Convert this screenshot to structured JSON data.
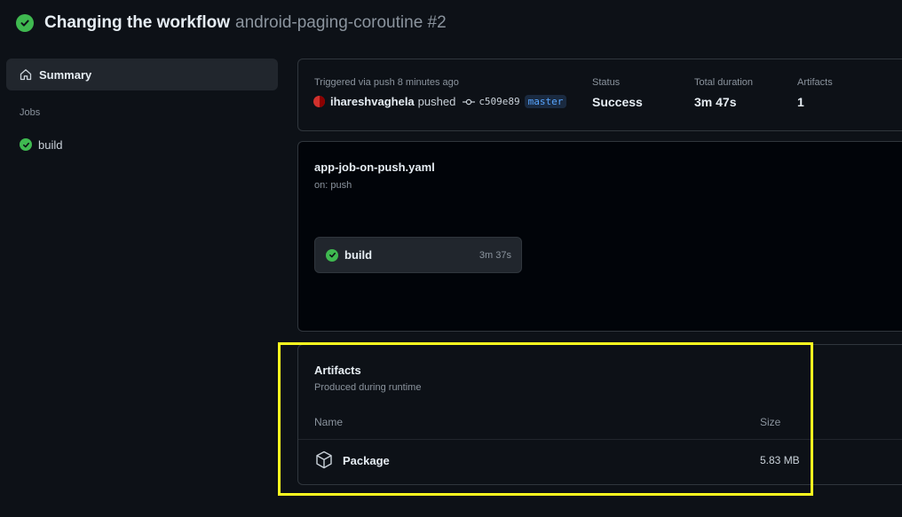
{
  "header": {
    "status_icon": "check-circle-icon",
    "title": "Changing the workflow",
    "subtitle": "android-paging-coroutine #2"
  },
  "sidebar": {
    "summary_label": "Summary",
    "summary_icon": "home-icon",
    "jobs_label": "Jobs",
    "jobs": [
      {
        "label": "build",
        "status": "success"
      }
    ]
  },
  "summary": {
    "trigger_label": "Triggered via push 8 minutes ago",
    "actor": "ihareshvaghela",
    "action": "pushed",
    "commit_sha": "c509e89",
    "branch": "master",
    "status_label": "Status",
    "status_value": "Success",
    "duration_label": "Total duration",
    "duration_value": "3m 47s",
    "artifacts_label": "Artifacts",
    "artifacts_value": "1"
  },
  "workflow": {
    "file_name": "app-job-on-push.yaml",
    "trigger": "on: push",
    "job": {
      "name": "build",
      "duration": "3m 37s"
    }
  },
  "artifacts": {
    "title": "Artifacts",
    "subtitle": "Produced during runtime",
    "columns": {
      "name": "Name",
      "size": "Size"
    },
    "items": [
      {
        "name": "Package",
        "size": "5.83 MB",
        "icon": "package-icon"
      }
    ]
  },
  "colors": {
    "success": "#3fb950",
    "background": "#0d1117",
    "highlight": "#ffff1f",
    "link": "#58a6ff"
  }
}
